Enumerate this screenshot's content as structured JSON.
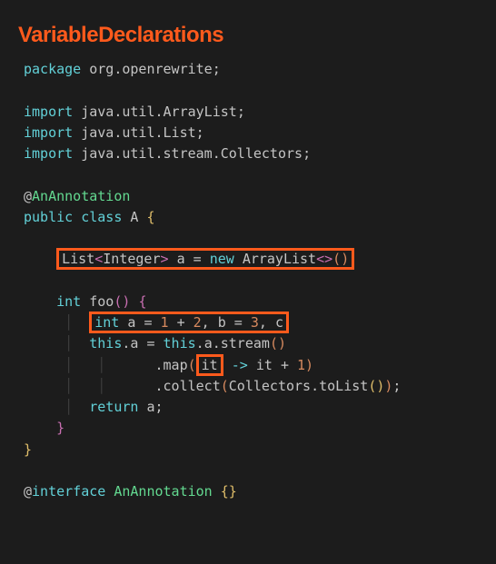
{
  "heading": "VariableDeclarations",
  "code": {
    "l1_package": "package",
    "l1_pkg": "org.openrewrite",
    "l3_import": "import",
    "l3_pkg": "java.util.ArrayList",
    "l4_import": "import",
    "l4_pkg": "java.util.List",
    "l5_import": "import",
    "l5_pkg": "java.util.stream.Collectors",
    "l7_at": "@",
    "l7_ann": "AnAnnotation",
    "l8_public": "public",
    "l8_class": "class",
    "l8_A": "A",
    "l8_brace": "{",
    "l10_List": "List",
    "l10_lt": "<",
    "l10_Integer": "Integer",
    "l10_gt": ">",
    "l10_a": "a",
    "l10_eq": "=",
    "l10_new": "new",
    "l10_ArrayList": "ArrayList",
    "l10_lt2": "<",
    "l10_gt2": ">",
    "l10_lp": "(",
    "l10_rp": ")",
    "l12_int": "int",
    "l12_foo": "foo",
    "l12_lp": "(",
    "l12_rp": ")",
    "l12_brace": "{",
    "l13_int": "int",
    "l13_a": "a",
    "l13_eq": "=",
    "l13_1": "1",
    "l13_plus": "+",
    "l13_2": "2",
    "l13_c1": ",",
    "l13_b": "b",
    "l13_eq2": "=",
    "l13_3": "3",
    "l13_c2": ",",
    "l13_c": "c",
    "l14_this1": "this",
    "l14_a1": "a",
    "l14_eq": "=",
    "l14_this2": "this",
    "l14_a2": "a",
    "l14_stream": "stream",
    "l14_lp": "(",
    "l14_rp": ")",
    "l15_map": "map",
    "l15_lp": "(",
    "l15_it": "it",
    "l15_arrow": "->",
    "l15_it2": "it",
    "l15_plus": "+",
    "l15_1": "1",
    "l15_rp": ")",
    "l16_collect": "collect",
    "l16_lp": "(",
    "l16_Collectors": "Collectors",
    "l16_toList": "toList",
    "l16_lp2": "(",
    "l16_rp2": ")",
    "l16_rp": ")",
    "l17_return": "return",
    "l17_a": "a",
    "l18_brace": "}",
    "l19_brace": "}",
    "l21_at": "@",
    "l21_interface": "interface",
    "l21_Ann": "AnAnnotation",
    "l21_lb": "{",
    "l21_rb": "}"
  }
}
